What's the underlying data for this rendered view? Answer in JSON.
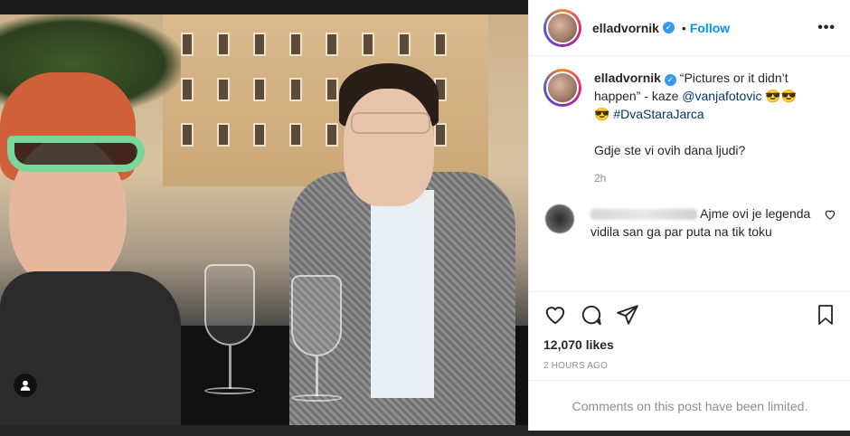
{
  "post": {
    "username": "elladvornik",
    "follow_label": "Follow",
    "dot": "•",
    "more": "•••"
  },
  "caption": {
    "username": "elladvornik",
    "text_part1": " “Pictures or it didn’t happen” - kaze ",
    "mention": "@vanjafotovic",
    "emoji1": " 😎😎",
    "emoji2": "😎 ",
    "hashtag": "#DvaStaraJarca",
    "line2": "Gdje ste vi ovih dana ljudi?",
    "time": "2h"
  },
  "comment": {
    "text": "Ajme ovi je legenda vidila san ga par puta na tik toku"
  },
  "stats": {
    "likes": "12,070 likes",
    "ago": "2 HOURS AGO"
  },
  "footer": {
    "limited": "Comments on this post have been limited."
  },
  "colors": {
    "link": "#00376b",
    "follow": "#0095f6",
    "verified": "#3897f0"
  }
}
